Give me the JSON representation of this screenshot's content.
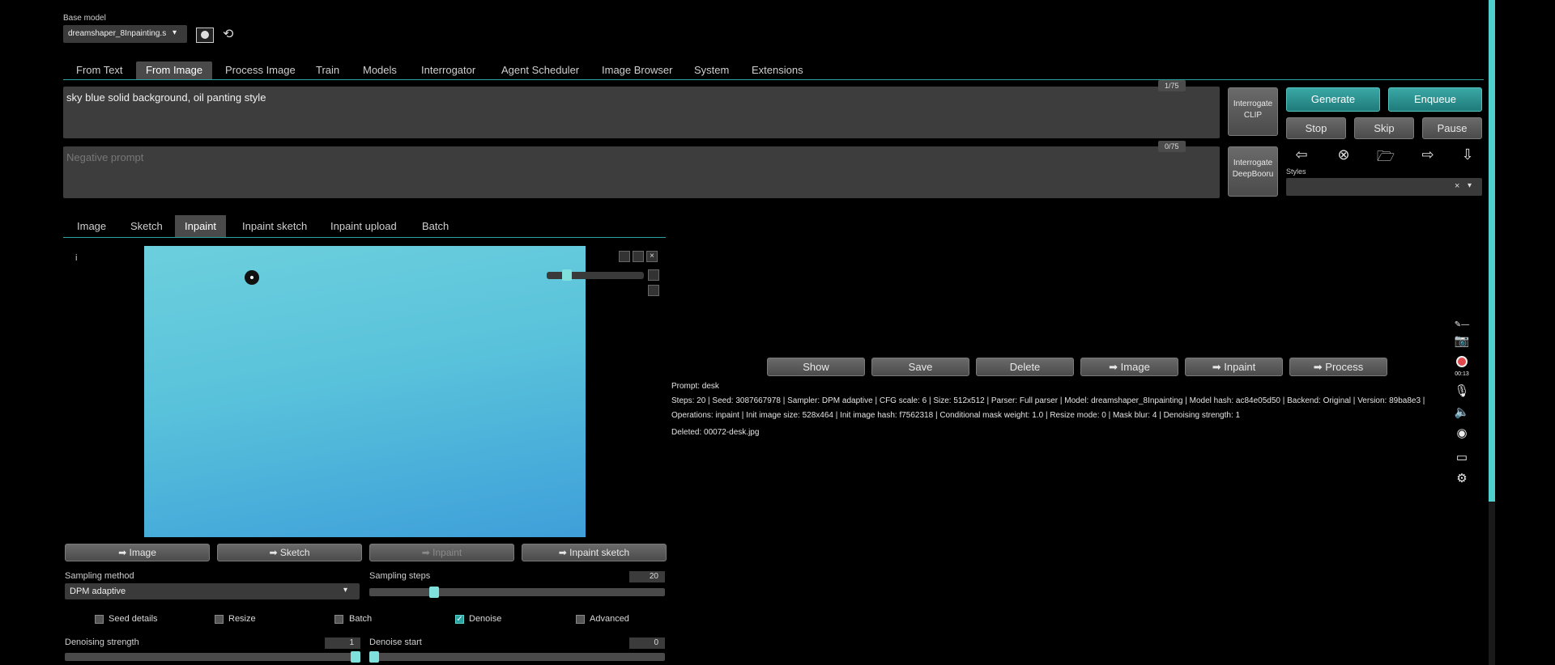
{
  "base_model": {
    "label": "Base model",
    "selected": "dreamshaper_8Inpainting.s"
  },
  "main_tabs": [
    {
      "label": "From Text"
    },
    {
      "label": "From Image"
    },
    {
      "label": "Process Image"
    },
    {
      "label": "Train"
    },
    {
      "label": "Models"
    },
    {
      "label": "Interrogator"
    },
    {
      "label": "Agent Scheduler"
    },
    {
      "label": "Image Browser"
    },
    {
      "label": "System"
    },
    {
      "label": "Extensions"
    }
  ],
  "prompt": {
    "value": "sky blue solid background, oil panting style",
    "counter": "1/75"
  },
  "negative_prompt": {
    "placeholder": "Negative prompt",
    "counter": "0/75"
  },
  "interrogate": {
    "clip": "Interrogate CLIP",
    "deepbooru": "Interrogate DeepBooru"
  },
  "actions": {
    "generate": "Generate",
    "enqueue": "Enqueue",
    "stop": "Stop",
    "skip": "Skip",
    "pause": "Pause"
  },
  "tool_icons": [
    "arrow-left-icon",
    "cancel-circle-icon",
    "folder-open-icon",
    "swap-icon",
    "arrow-down-icon"
  ],
  "styles": {
    "label": "Styles",
    "clear": "×",
    "arrow": "▾"
  },
  "sub_tabs": [
    {
      "label": "Image"
    },
    {
      "label": "Sketch"
    },
    {
      "label": "Inpaint"
    },
    {
      "label": "Inpaint sketch"
    },
    {
      "label": "Inpaint upload"
    },
    {
      "label": "Batch"
    }
  ],
  "canvas": {
    "info_marker": "i",
    "brush_size_fraction": 0.18
  },
  "send_buttons": {
    "image": "➡ Image",
    "sketch": "➡ Sketch",
    "inpaint": "➡ Inpaint",
    "inpaint_sketch": "➡ Inpaint sketch"
  },
  "sampling": {
    "method_label": "Sampling method",
    "method_value": "DPM adaptive",
    "steps_label": "Sampling steps",
    "steps_value": "20",
    "steps_fraction": 0.21
  },
  "checkboxes": [
    {
      "label": "Seed details",
      "checked": false
    },
    {
      "label": "Resize",
      "checked": false
    },
    {
      "label": "Batch",
      "checked": false
    },
    {
      "label": "Denoise",
      "checked": true
    },
    {
      "label": "Advanced",
      "checked": false
    }
  ],
  "denoise": {
    "strength_label": "Denoising strength",
    "strength_value": "1",
    "strength_fraction": 1.0,
    "start_label": "Denoise start",
    "start_value": "0",
    "start_fraction": 0.0
  },
  "gallery_buttons": {
    "show": "Show",
    "save": "Save",
    "delete": "Delete",
    "image": "➡ Image",
    "inpaint": "➡ Inpaint",
    "process": "➡ Process"
  },
  "output_info": {
    "prompt_line": "Prompt: desk",
    "params_line": "Steps: 20 | Seed: 3087667978 | Sampler: DPM adaptive | CFG scale: 6 | Size: 512x512 | Parser: Full parser | Model: dreamshaper_8Inpainting | Model hash: ac84e05d50 | Backend: Original | Version: 89ba8e3 |",
    "ops_line": "Operations: inpaint | Init image size: 528x464 | Init image hash: f7562318 | Conditional mask weight: 1.0 | Resize mode: 0 | Mask blur: 4 | Denoising strength: 1",
    "deleted_line": "Deleted: 00072-desk.jpg"
  },
  "recorder": {
    "time": "00:13"
  },
  "colors": {
    "accent": "#2aa3a0",
    "canvas_top": "#5cc6d8",
    "canvas_bottom": "#3a9fd8",
    "scrollbar": "#4fd0cc"
  }
}
